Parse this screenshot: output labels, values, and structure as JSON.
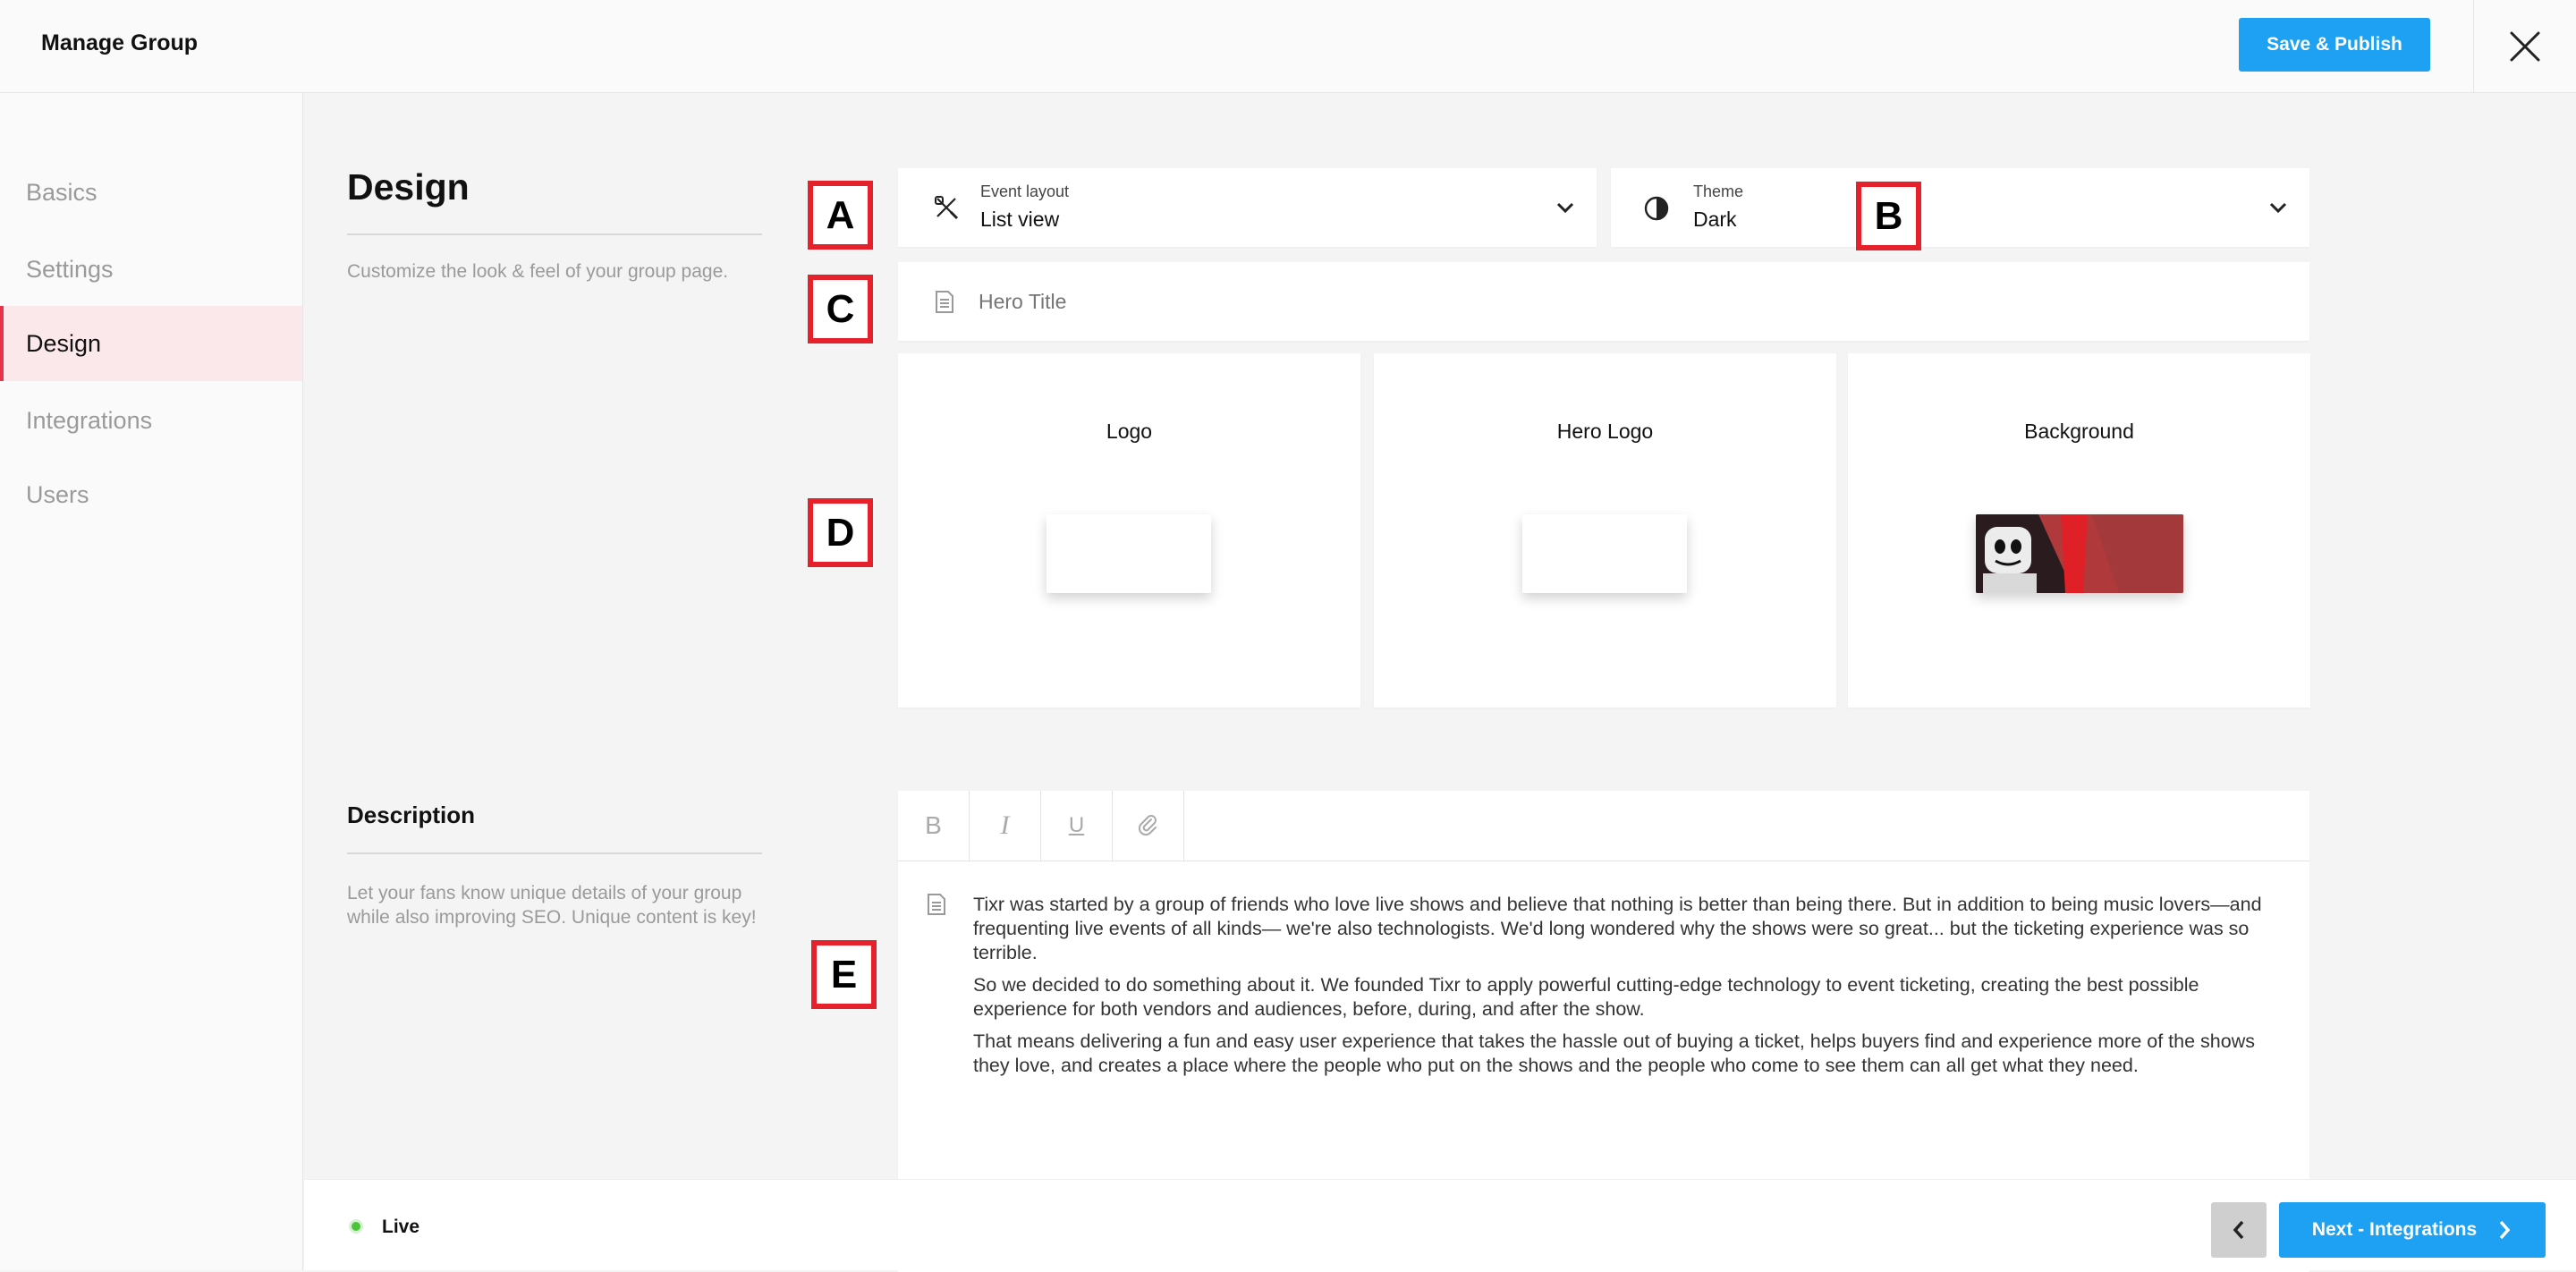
{
  "header": {
    "title": "Manage Group",
    "publish_label": "Save & Publish"
  },
  "sidebar": {
    "items": [
      {
        "label": "Basics"
      },
      {
        "label": "Settings"
      },
      {
        "label": "Design",
        "active": true
      },
      {
        "label": "Integrations"
      },
      {
        "label": "Users"
      }
    ]
  },
  "design": {
    "title": "Design",
    "subtitle": "Customize the look & feel of your group page.",
    "event_layout": {
      "label": "Event layout",
      "value": "List view"
    },
    "theme": {
      "label": "Theme",
      "value": "Dark"
    },
    "hero_title": {
      "placeholder": "Hero Title",
      "value": ""
    },
    "images": [
      {
        "label": "Logo"
      },
      {
        "label": "Hero Logo"
      },
      {
        "label": "Background"
      }
    ]
  },
  "description": {
    "title": "Description",
    "subtitle": "Let your fans know unique details of your group while also improving SEO. Unique content is key!",
    "toolbar": [
      "bold-icon",
      "italic-icon",
      "underline-icon",
      "link-icon"
    ],
    "paragraphs": [
      "Tixr was started by a group of friends who love live shows and believe that nothing is better than being there. But in addition to being music lovers—and frequenting live events of all kinds— we're also technologists. We'd long wondered why the shows were so great... but the ticketing experience was so terrible.",
      "So we decided to do something about it. We founded Tixr to apply powerful cutting-edge technology to event ticketing, creating the best possible experience for both vendors and audiences, before, during, and after the show.",
      "That means delivering a fun and easy user experience that takes the hassle out of buying a ticket, helps buyers find and experience more of the shows they love, and creates a place where the people who put on the shows and the people who come to see them can all get what they need."
    ]
  },
  "markers": {
    "a": "A",
    "b": "B",
    "c": "C",
    "d": "D",
    "e": "E"
  },
  "footer": {
    "status": "Live",
    "status_color": "#4cc43a",
    "next_label": "Next - Integrations"
  },
  "colors": {
    "accent": "#1ea1f2",
    "active_nav": "#e8344b",
    "marker_border": "#e5222b"
  }
}
